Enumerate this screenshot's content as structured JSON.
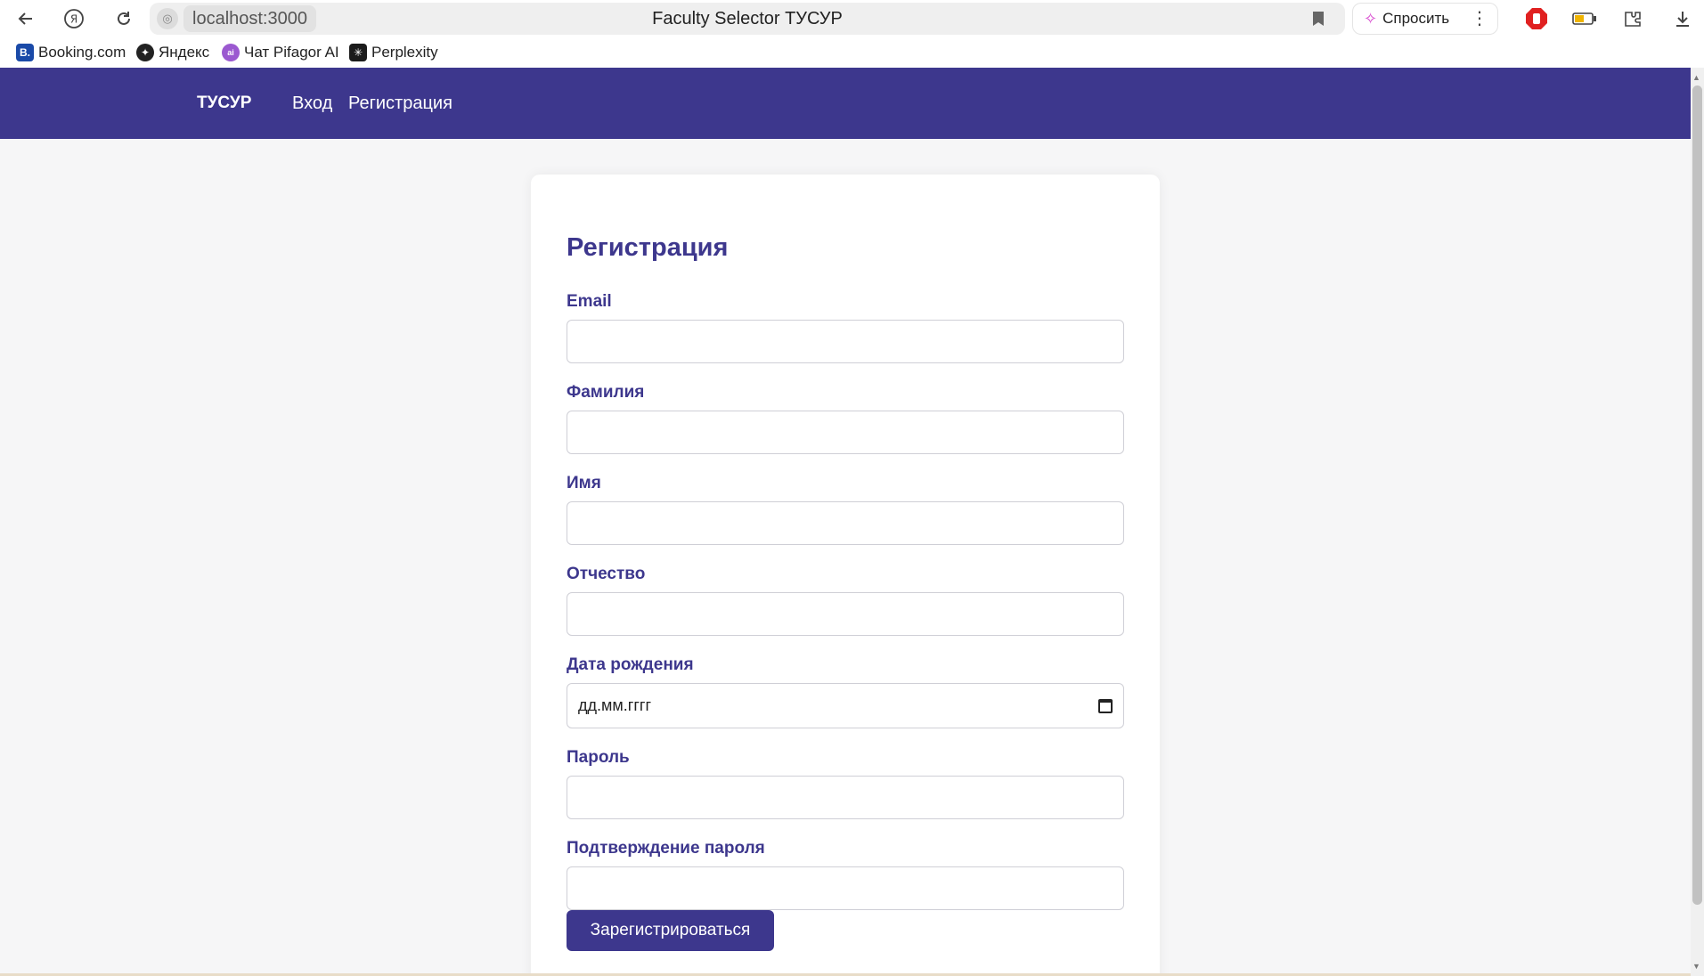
{
  "browser": {
    "url": "localhost:3000",
    "tab_title": "Faculty Selector ТУСУР",
    "ask_label": "Спросить",
    "more_label": "⋮",
    "bookmarks": [
      {
        "label": "Booking.com",
        "icon": "B.",
        "color": "#1a4aa8"
      },
      {
        "label": "Яндекс",
        "icon": "✦",
        "color": "#222222"
      },
      {
        "label": "Чат Pifagor AI",
        "icon": "ai",
        "color": "#9b59d0"
      },
      {
        "label": "Perplexity",
        "icon": "✳",
        "color": "#1b1b1b"
      }
    ]
  },
  "nav": {
    "brand": "ТУСУР",
    "links": [
      "Вход",
      "Регистрация"
    ]
  },
  "form": {
    "title": "Регистрация",
    "fields": [
      {
        "label": "Email",
        "value": ""
      },
      {
        "label": "Фамилия",
        "value": ""
      },
      {
        "label": "Имя",
        "value": ""
      },
      {
        "label": "Отчество",
        "value": ""
      },
      {
        "label": "Дата рождения",
        "value": "дд.мм.гггг"
      },
      {
        "label": "Пароль",
        "value": ""
      },
      {
        "label": "Подтверждение пароля",
        "value": ""
      }
    ],
    "submit_label": "Зарегистрироваться"
  },
  "colors": {
    "primary": "#3d378d",
    "page_bg": "#f6f6f7"
  }
}
